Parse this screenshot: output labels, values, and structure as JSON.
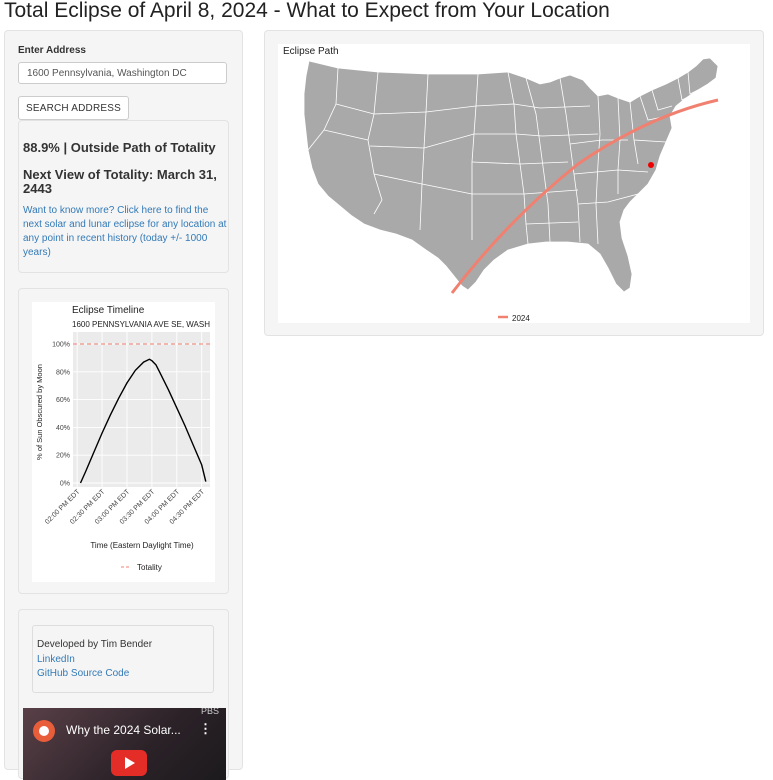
{
  "page": {
    "title": "Total Eclipse of April 8, 2024 - What to Expect from Your Location"
  },
  "sidebar": {
    "address_label": "Enter Address",
    "address_value": "1600 Pennsylvania, Washington DC",
    "search_button": "SEARCH ADDRESS",
    "result": {
      "coverage_line": "88.9% | Outside Path of Totality",
      "next_totality": "Next View of Totality: March 31, 2443",
      "more_link": "Want to know more? Click here to find the next solar and lunar eclipse for any location at any point in recent history (today +/- 1000 years)"
    },
    "credits": {
      "developer": "Developed by Tim Bender",
      "linkedin": "LinkedIn",
      "github": "GitHub Source Code"
    },
    "video": {
      "title": "Why the 2024 Solar...",
      "channel": "PBS",
      "menu_icon": "more-vert-icon",
      "play_icon": "play-icon"
    }
  },
  "map": {
    "title": "Eclipse Path",
    "legend_label": "2024",
    "colors": {
      "land": "#a9a9a9",
      "borders": "#ffffff",
      "path": "#f08070",
      "marker": "#ee0000"
    }
  },
  "chart_data": {
    "type": "line",
    "title": "Eclipse Timeline",
    "subtitle": "1600 PENNSYLVANIA AVE SE, WASH",
    "xlabel": "Time (Eastern Daylight Time)",
    "ylabel": "% of Sun Obscured by Moon",
    "x_ticks": [
      "02:00 PM EDT",
      "02:30 PM EDT",
      "03:00 PM EDT",
      "03:30 PM EDT",
      "04:00 PM EDT",
      "04:30 PM EDT"
    ],
    "y_ticks": [
      "0%",
      "20%",
      "40%",
      "60%",
      "80%",
      "100%"
    ],
    "ylim": [
      0,
      100
    ],
    "x_minutes_after_2pm": [
      4,
      10,
      20,
      30,
      40,
      50,
      60,
      70,
      80,
      87,
      90,
      95,
      100,
      110,
      120,
      130,
      140,
      150,
      155
    ],
    "values": [
      0,
      8,
      22,
      36,
      49,
      61,
      72,
      81,
      87,
      89,
      88,
      85,
      79,
      67,
      54,
      41,
      27,
      13,
      1
    ],
    "legend": [
      {
        "name": "Totality",
        "value": 100,
        "style": "dashed",
        "color": "#f08070"
      }
    ],
    "series_color": "#000000",
    "grid": true,
    "legend_position": "bottom"
  }
}
